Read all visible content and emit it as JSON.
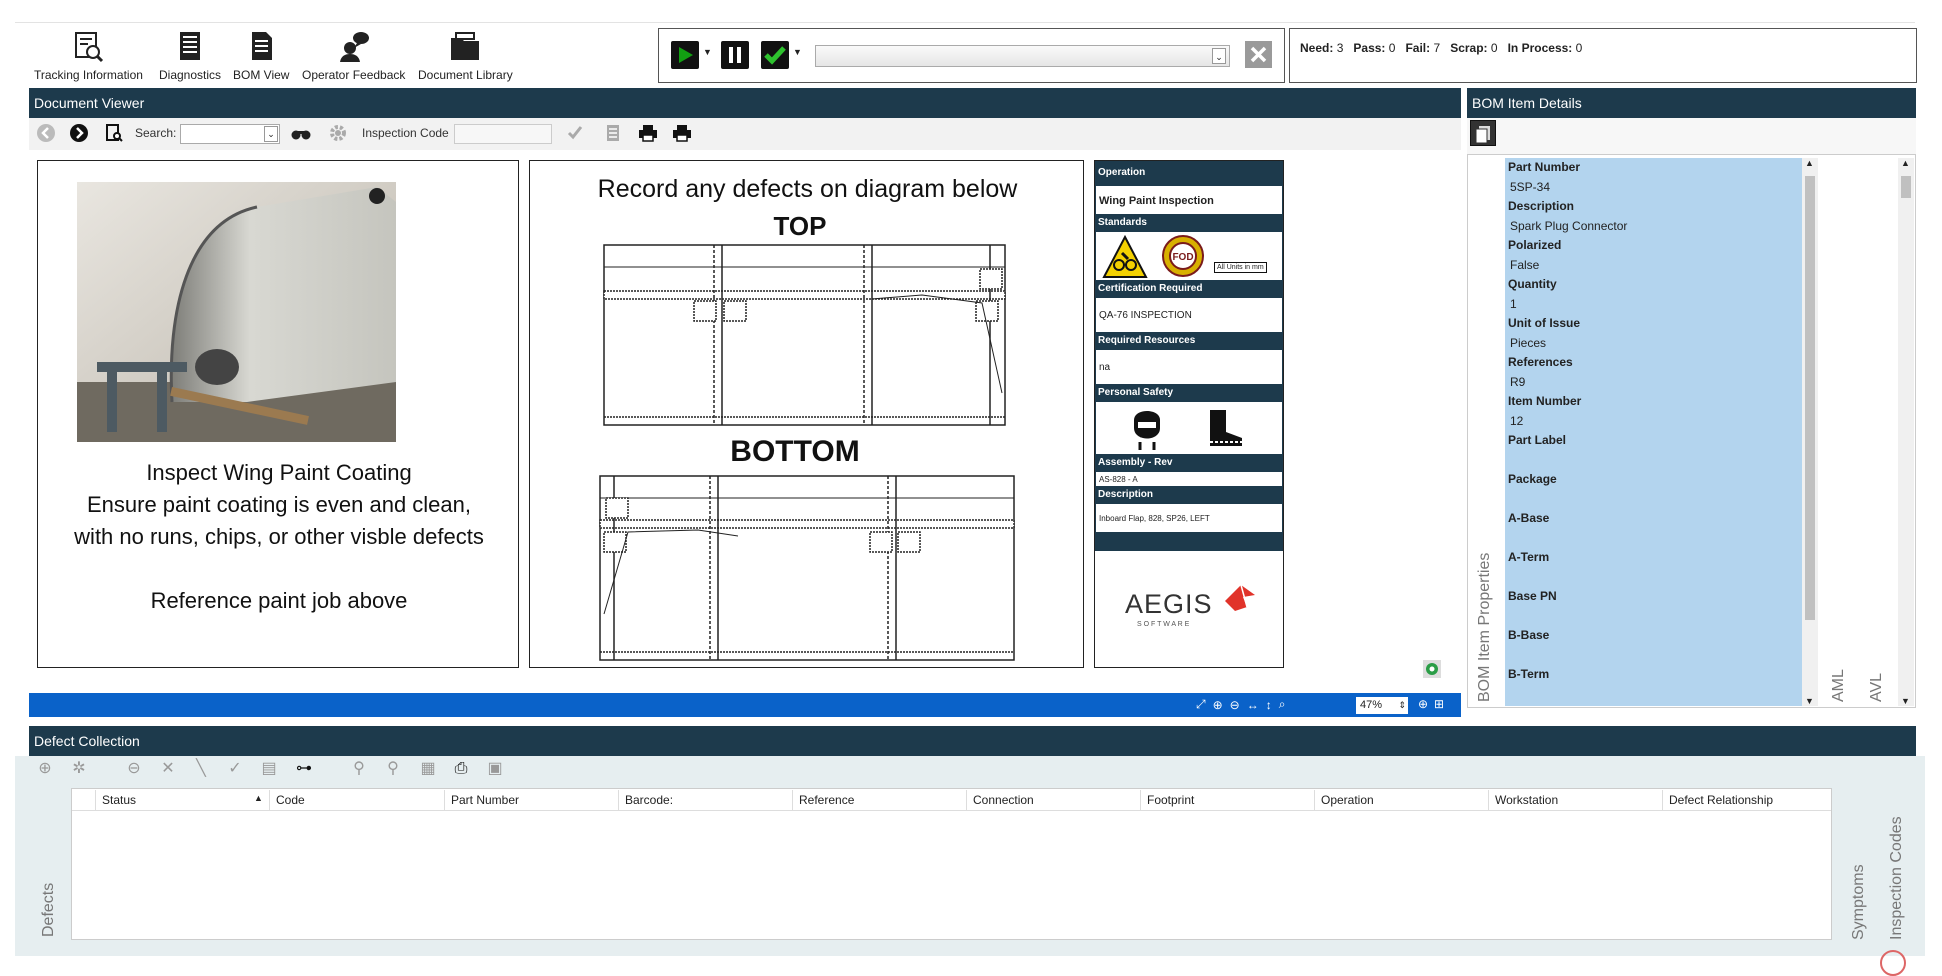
{
  "toolbar": {
    "buttons": [
      {
        "label": "Tracking Information",
        "icon": "tracking-icon"
      },
      {
        "label": "Diagnostics",
        "icon": "diagnostics-icon"
      },
      {
        "label": "BOM View",
        "icon": "bom-view-icon"
      },
      {
        "label": "Operator Feedback",
        "icon": "operator-feedback-icon"
      },
      {
        "label": "Document Library",
        "icon": "document-library-icon"
      }
    ]
  },
  "status": {
    "need_label": "Need:",
    "need": "3",
    "pass_label": "Pass:",
    "pass": "0",
    "fail_label": "Fail:",
    "fail": "7",
    "scrap_label": "Scrap:",
    "scrap": "0",
    "in_process_label": "In Process:",
    "in_process": "0"
  },
  "document_viewer": {
    "title": "Document Viewer",
    "search_label": "Search:",
    "inspection_code_label": "Inspection Code",
    "zoom": "47%",
    "left_doc": {
      "lines": [
        "Inspect Wing Paint Coating",
        "Ensure paint coating is even and clean,",
        "with no runs, chips, or other visble defects",
        "",
        "Reference paint job above"
      ]
    },
    "diagram": {
      "heading": "Record any defects on diagram below",
      "top_label": "TOP",
      "bottom_label": "BOTTOM"
    },
    "op_sheet": {
      "operation_label": "Operation",
      "operation": "Wing Paint Inspection",
      "standards_label": "Standards",
      "units_note": "All Units in mm",
      "fod_text": "FOD",
      "certification_label": "Certification Required",
      "certification": "QA-76 INSPECTION",
      "resources_label": "Required Resources",
      "resources": "na",
      "safety_label": "Personal Safety",
      "assembly_label": "Assembly - Rev",
      "assembly": "AS-828 - A",
      "description_label": "Description",
      "description": "Inboard Flap, 828, SP26, LEFT",
      "logo_text": "AEGIS",
      "logo_sub": "S O F T W A R E"
    }
  },
  "bom": {
    "title": "BOM Item Details",
    "vertical_tab": "BOM Item Properties",
    "right_tabs": [
      "AML",
      "AVL"
    ],
    "fields": [
      {
        "label": "Part Number",
        "value": "5SP-34"
      },
      {
        "label": "Description",
        "value": "Spark Plug Connector"
      },
      {
        "label": "Polarized",
        "value": "False"
      },
      {
        "label": "Quantity",
        "value": "1"
      },
      {
        "label": "Unit of Issue",
        "value": "Pieces"
      },
      {
        "label": "References",
        "value": "R9"
      },
      {
        "label": "Item Number",
        "value": "12"
      },
      {
        "label": "Part Label",
        "value": ""
      },
      {
        "label": "Package",
        "value": ""
      },
      {
        "label": "A-Base",
        "value": ""
      },
      {
        "label": "A-Term",
        "value": ""
      },
      {
        "label": "Base PN",
        "value": ""
      },
      {
        "label": "B-Base",
        "value": ""
      },
      {
        "label": "B-Term",
        "value": ""
      }
    ]
  },
  "defects": {
    "title": "Defect Collection",
    "vertical_tab": "Defects",
    "right_tabs": [
      "Symptoms",
      "Inspection Codes"
    ],
    "columns": [
      "Status",
      "Code",
      "Part Number",
      "Barcode:",
      "Reference",
      "Connection",
      "Footprint",
      "Operation",
      "Workstation",
      "Defect Relationship"
    ]
  },
  "colors": {
    "header": "#1d3a4c",
    "bom_highlight": "#b3d4ee",
    "blue_bar": "#0a62c9",
    "play_green": "#12a012"
  }
}
